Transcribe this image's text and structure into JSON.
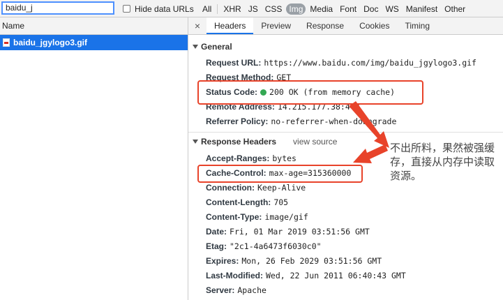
{
  "toolbar": {
    "filter_value": "baidu_j",
    "hide_data_urls_label": "Hide data URLs",
    "type_filters": [
      "All",
      "XHR",
      "JS",
      "CSS",
      "Img",
      "Media",
      "Font",
      "Doc",
      "WS",
      "Manifest",
      "Other"
    ],
    "active_filter": "Img"
  },
  "list": {
    "name_header": "Name",
    "items": [
      {
        "name": "baidu_jgylogo3.gif"
      }
    ]
  },
  "detail": {
    "tabs": [
      "Headers",
      "Preview",
      "Response",
      "Cookies",
      "Timing"
    ],
    "active_tab": "Headers",
    "general": {
      "title": "General",
      "rows": [
        {
          "key": "Request URL:",
          "value": "https://www.baidu.com/img/baidu_jgylogo3.gif"
        },
        {
          "key": "Request Method:",
          "value": "GET"
        },
        {
          "key": "Status Code:",
          "value": "200 OK (from memory cache)"
        },
        {
          "key": "Remote Address:",
          "value": "14.215.177.38:443"
        },
        {
          "key": "Referrer Policy:",
          "value": "no-referrer-when-downgrade"
        }
      ]
    },
    "response_headers": {
      "title": "Response Headers",
      "view_source": "view source",
      "rows": [
        {
          "key": "Accept-Ranges:",
          "value": "bytes"
        },
        {
          "key": "Cache-Control:",
          "value": "max-age=315360000"
        },
        {
          "key": "Connection:",
          "value": "Keep-Alive"
        },
        {
          "key": "Content-Length:",
          "value": "705"
        },
        {
          "key": "Content-Type:",
          "value": "image/gif"
        },
        {
          "key": "Date:",
          "value": "Fri, 01 Mar 2019 03:51:56 GMT"
        },
        {
          "key": "Etag:",
          "value": "\"2c1-4a6473f6030c0\""
        },
        {
          "key": "Expires:",
          "value": "Mon, 26 Feb 2029 03:51:56 GMT"
        },
        {
          "key": "Last-Modified:",
          "value": "Wed, 22 Jun 2011 06:40:43 GMT"
        },
        {
          "key": "Server:",
          "value": "Apache"
        }
      ]
    }
  },
  "annotation": {
    "note": "不出所料，果然被强缓存，直接从内存中读取资源。",
    "color": "#e8432a"
  },
  "colors": {
    "accent": "#1a73e8",
    "status_ok": "#34a853"
  }
}
